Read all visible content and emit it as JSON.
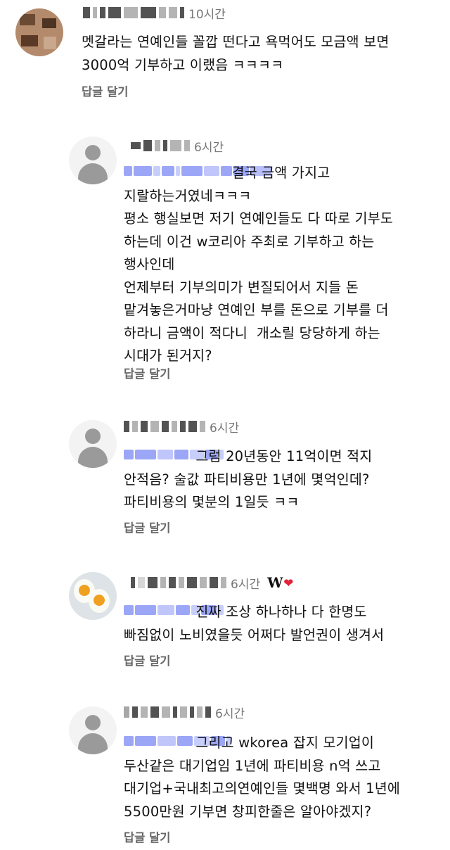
{
  "comments": [
    {
      "time": "10시간",
      "text": "멧갈라는 연예인들 꼴깝 떤다고 욕먹어도 모금액 보면\n3000억 기부하고 이랬음 ㅋㅋㅋㅋ",
      "reply_label": "답글 달기"
    },
    {
      "time": "6시간",
      "text": "                        결국 금액 가지고\n지랄하는거였네ㅋㅋㅋ\n평소 행실보면 저기 연예인들도 다 따로 기부도\n하는데 이건 w코리아 주최로 기부하고 하는\n행사인데\n언제부터 기부의미가 변질되어서 지들 돈\n맡겨놓은거마냥 연예인 부를 돈으로 기부를 더\n하라니 금액이 적다니  개소릴 당당하게 하는\n시대가 된거지?",
      "reply_label": "답글 달기"
    },
    {
      "time": "6시간",
      "text": "                그럼 20년동안 11억이면 적지\n안적음? 술값 파티비용만 1년에 몇억인데?\n파티비용의 몇분의 1일듯 ㅋㅋ",
      "reply_label": "답글 달기"
    },
    {
      "time": "6시간",
      "badge": "W",
      "text": "                진짜 조상 하나하나 다 한명도\n빠짐없이 노비였을듯 어쩌다 발언권이 생겨서",
      "reply_label": "답글 달기"
    },
    {
      "time": "6시간",
      "text": "                그리고 wkorea 잡지 모기업이\n두산같은 대기업임 1년에 파티비용 n억 쓰고\n대기업+국내최고의연예인들 몇백명 와서 1년에\n5500만원 기부면 창피한줄은 알아야겠지?",
      "reply_label": "답글 달기"
    }
  ]
}
